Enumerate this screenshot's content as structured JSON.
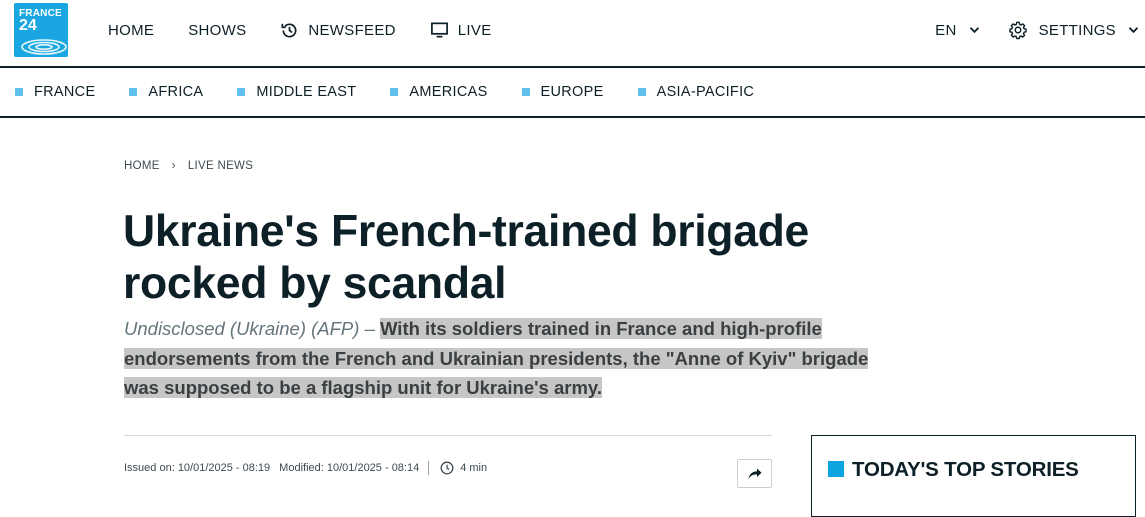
{
  "brand": {
    "line1": "FRANCE",
    "line2": "24"
  },
  "main_nav": [
    {
      "label": "HOME",
      "icon": null
    },
    {
      "label": "SHOWS",
      "icon": null
    },
    {
      "label": "NEWSFEED",
      "icon": "history-icon"
    },
    {
      "label": "LIVE",
      "icon": "monitor-icon"
    }
  ],
  "language": {
    "label": "EN"
  },
  "settings": {
    "label": "SETTINGS"
  },
  "regions": [
    "FRANCE",
    "AFRICA",
    "MIDDLE EAST",
    "AMERICAS",
    "EUROPE",
    "ASIA-PACIFIC"
  ],
  "breadcrumb": {
    "home": "HOME",
    "separator": "›",
    "current": "LIVE NEWS"
  },
  "article": {
    "headline": "Ukraine's French-trained brigade rocked by scandal",
    "dateline": "Undisclosed (Ukraine) (AFP) –",
    "lead": "With its soldiers trained in France and high-profile endorsements from the French and Ukrainian presidents, the \"Anne of Kyiv\" brigade was supposed to be a flagship unit for Ukraine's army.",
    "issued": "Issued on: 10/01/2025 - 08:19",
    "modified": "Modified: 10/01/2025 - 08:14",
    "read_time": "4 min"
  },
  "sidebar": {
    "top_stories_title": "TODAY'S TOP STORIES"
  },
  "colors": {
    "accent": "#1aa7e1",
    "region_marker": "#62c0ee",
    "text": "#0d1f27",
    "highlight": "#c6c6c6"
  }
}
